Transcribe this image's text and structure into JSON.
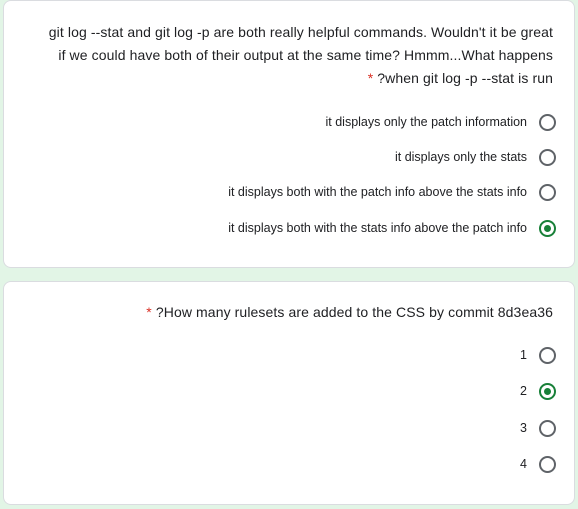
{
  "questions": [
    {
      "title_lines": [
        "git log --stat and git log -p are both really helpful commands. Wouldn't it be great",
        "if we could have both of their output at the same time? Hmmm...What happens",
        "?when git log -p --stat is run"
      ],
      "required_mark": "*",
      "options": [
        {
          "label": "it displays only the patch information",
          "selected": false
        },
        {
          "label": "it displays only the stats",
          "selected": false
        },
        {
          "label": "it displays both with the patch info above the stats info",
          "selected": false
        },
        {
          "label": "it displays both with the stats info above the patch info",
          "selected": true
        }
      ]
    },
    {
      "title": "?How many rulesets are added to the CSS by commit 8d3ea36",
      "required_mark": "*",
      "options": [
        {
          "label": "1",
          "selected": false
        },
        {
          "label": "2",
          "selected": true
        },
        {
          "label": "3",
          "selected": false
        },
        {
          "label": "4",
          "selected": false
        }
      ]
    }
  ],
  "colors": {
    "page_background": "#e2f5e6",
    "selected_radio": "#188038",
    "required_asterisk": "#d93025"
  }
}
